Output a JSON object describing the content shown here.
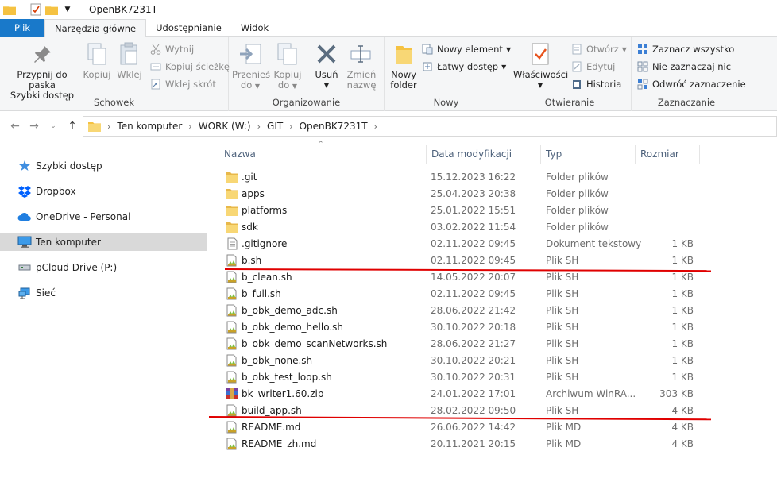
{
  "window": {
    "title": "OpenBK7231T"
  },
  "tabs": [
    {
      "label": "Plik"
    },
    {
      "label": "Narzędzia główne"
    },
    {
      "label": "Udostępnianie"
    },
    {
      "label": "Widok"
    }
  ],
  "ribbon": {
    "schowek": {
      "label": "Schowek",
      "pin_line1": "Przypnij do paska",
      "pin_line2": "Szybki dostęp",
      "copy": "Kopiuj",
      "paste": "Wklej",
      "cut": "Wytnij",
      "copy_path": "Kopiuj ścieżkę",
      "paste_shortcut": "Wklej skrót"
    },
    "organizowanie": {
      "label": "Organizowanie",
      "move_line1": "Przenieś",
      "move_line2": "do",
      "copyto_line1": "Kopiuj",
      "copyto_line2": "do",
      "delete_line1": "Usuń",
      "rename_line1": "Zmień",
      "rename_line2": "nazwę"
    },
    "nowy": {
      "label": "Nowy",
      "folder_line1": "Nowy",
      "folder_line2": "folder",
      "new_item": "Nowy element",
      "easy_access": "Łatwy dostęp"
    },
    "otwieranie": {
      "label": "Otwieranie",
      "properties": "Właściwości",
      "open": "Otwórz",
      "edit": "Edytuj",
      "history": "Historia"
    },
    "zaznaczanie": {
      "label": "Zaznaczanie",
      "select_all": "Zaznacz wszystko",
      "select_none": "Nie zaznaczaj nic",
      "invert": "Odwróć zaznaczenie"
    }
  },
  "address": {
    "crumbs": [
      "Ten komputer",
      "WORK (W:)",
      "GIT",
      "OpenBK7231T"
    ]
  },
  "navpane": [
    {
      "label": "Szybki dostęp",
      "icon": "star-icon"
    },
    {
      "label": "Dropbox",
      "icon": "dropbox-icon"
    },
    {
      "label": "OneDrive - Personal",
      "icon": "cloud-icon"
    },
    {
      "label": "Ten komputer",
      "icon": "computer-icon",
      "selected": true
    },
    {
      "label": "pCloud Drive (P:)",
      "icon": "drive-icon"
    },
    {
      "label": "Sieć",
      "icon": "network-icon"
    }
  ],
  "columns": {
    "name": "Nazwa",
    "date": "Data modyfikacji",
    "type": "Typ",
    "size": "Rozmiar"
  },
  "files": [
    {
      "name": ".git",
      "date": "15.12.2023 16:22",
      "type": "Folder plików",
      "size": "",
      "icon": "folder"
    },
    {
      "name": "apps",
      "date": "25.04.2023 20:38",
      "type": "Folder plików",
      "size": "",
      "icon": "folder"
    },
    {
      "name": "platforms",
      "date": "25.01.2022 15:51",
      "type": "Folder plików",
      "size": "",
      "icon": "folder"
    },
    {
      "name": "sdk",
      "date": "03.02.2022 11:54",
      "type": "Folder plików",
      "size": "",
      "icon": "folder"
    },
    {
      "name": ".gitignore",
      "date": "02.11.2022 09:45",
      "type": "Dokument tekstowy",
      "size": "1 KB",
      "icon": "text"
    },
    {
      "name": "b.sh",
      "date": "02.11.2022 09:45",
      "type": "Plik SH",
      "size": "1 KB",
      "icon": "script"
    },
    {
      "name": "b_clean.sh",
      "date": "14.05.2022 20:07",
      "type": "Plik SH",
      "size": "1 KB",
      "icon": "script"
    },
    {
      "name": "b_full.sh",
      "date": "02.11.2022 09:45",
      "type": "Plik SH",
      "size": "1 KB",
      "icon": "script"
    },
    {
      "name": "b_obk_demo_adc.sh",
      "date": "28.06.2022 21:42",
      "type": "Plik SH",
      "size": "1 KB",
      "icon": "script"
    },
    {
      "name": "b_obk_demo_hello.sh",
      "date": "30.10.2022 20:18",
      "type": "Plik SH",
      "size": "1 KB",
      "icon": "script"
    },
    {
      "name": "b_obk_demo_scanNetworks.sh",
      "date": "28.06.2022 21:27",
      "type": "Plik SH",
      "size": "1 KB",
      "icon": "script"
    },
    {
      "name": "b_obk_none.sh",
      "date": "30.10.2022 20:21",
      "type": "Plik SH",
      "size": "1 KB",
      "icon": "script"
    },
    {
      "name": "b_obk_test_loop.sh",
      "date": "30.10.2022 20:31",
      "type": "Plik SH",
      "size": "1 KB",
      "icon": "script"
    },
    {
      "name": "bk_writer1.60.zip",
      "date": "24.01.2022 17:01",
      "type": "Archiwum WinRA...",
      "size": "303 KB",
      "icon": "archive"
    },
    {
      "name": "build_app.sh",
      "date": "28.02.2022 09:50",
      "type": "Plik SH",
      "size": "4 KB",
      "icon": "script"
    },
    {
      "name": "README.md",
      "date": "26.06.2022 14:42",
      "type": "Plik MD",
      "size": "4 KB",
      "icon": "script"
    },
    {
      "name": "README_zh.md",
      "date": "20.11.2021 20:15",
      "type": "Plik MD",
      "size": "4 KB",
      "icon": "script"
    }
  ],
  "colors": {
    "accent": "#1979ca",
    "annotation": "#e00000",
    "folder": "#f8d775"
  }
}
